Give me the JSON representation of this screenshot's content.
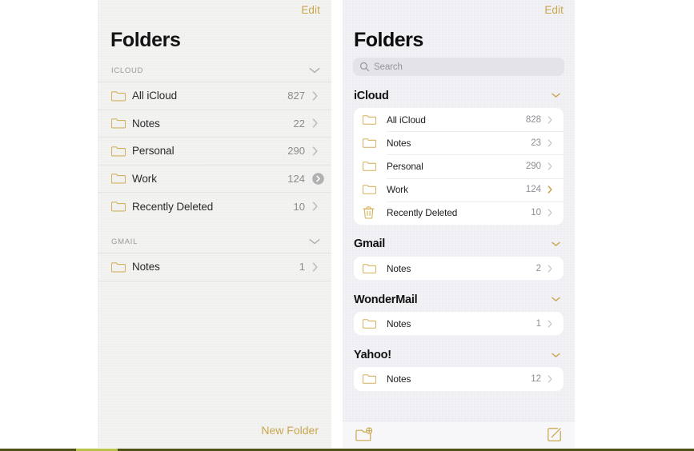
{
  "theme": {
    "accent_gold": "#c9a74e",
    "folder_gold": "#d4b15c",
    "count_gray": "#8b8b8b",
    "left_bg": "#f3f3f2",
    "right_bg": "#f1f1f6",
    "card_white": "#ffffff"
  },
  "left_panel": {
    "edit_label": "Edit",
    "title": "Folders",
    "new_folder_label": "New Folder",
    "sections": [
      {
        "label": "ICLOUD",
        "collapse_icon": "chevron-down-icon",
        "rows": [
          {
            "icon": "folder-icon",
            "label": "All iCloud",
            "count": "827",
            "accessory": "chevron-right-icon"
          },
          {
            "icon": "folder-icon",
            "label": "Notes",
            "count": "22",
            "accessory": "chevron-right-icon"
          },
          {
            "icon": "folder-icon",
            "label": "Personal",
            "count": "290",
            "accessory": "chevron-right-icon"
          },
          {
            "icon": "folder-icon",
            "label": "Work",
            "count": "124",
            "accessory": "chevron-right-circle-filled-icon"
          },
          {
            "icon": "folder-icon",
            "label": "Recently Deleted",
            "count": "10",
            "accessory": "chevron-right-icon"
          }
        ]
      },
      {
        "label": "GMAIL",
        "collapse_icon": "chevron-down-icon",
        "rows": [
          {
            "icon": "folder-icon",
            "label": "Notes",
            "count": "1",
            "accessory": "chevron-right-icon"
          }
        ]
      }
    ]
  },
  "right_panel": {
    "edit_label": "Edit",
    "title": "Folders",
    "search": {
      "value": "",
      "placeholder": "Search",
      "icon": "search-icon"
    },
    "sections": [
      {
        "label": "iCloud",
        "collapse_icon": "chevron-down-icon",
        "rows": [
          {
            "icon": "folder-icon",
            "label": "All iCloud",
            "count": "828",
            "chevron_highlight": false
          },
          {
            "icon": "folder-icon",
            "label": "Notes",
            "count": "23",
            "chevron_highlight": false
          },
          {
            "icon": "folder-icon",
            "label": "Personal",
            "count": "290",
            "chevron_highlight": false
          },
          {
            "icon": "folder-icon",
            "label": "Work",
            "count": "124",
            "chevron_highlight": true
          },
          {
            "icon": "trash-icon",
            "label": "Recently Deleted",
            "count": "10",
            "chevron_highlight": false
          }
        ]
      },
      {
        "label": "Gmail",
        "collapse_icon": "chevron-down-icon",
        "rows": [
          {
            "icon": "folder-icon",
            "label": "Notes",
            "count": "2",
            "chevron_highlight": false
          }
        ]
      },
      {
        "label": "WonderMail",
        "collapse_icon": "chevron-down-icon",
        "rows": [
          {
            "icon": "folder-icon",
            "label": "Notes",
            "count": "1",
            "chevron_highlight": false
          }
        ]
      },
      {
        "label": "Yahoo!",
        "collapse_icon": "chevron-down-icon",
        "rows": [
          {
            "icon": "folder-icon",
            "label": "Notes",
            "count": "12",
            "chevron_highlight": false
          }
        ]
      }
    ],
    "toolbar": {
      "new_folder_icon": "folder-plus-icon",
      "compose_icon": "compose-square-pencil-icon"
    }
  }
}
